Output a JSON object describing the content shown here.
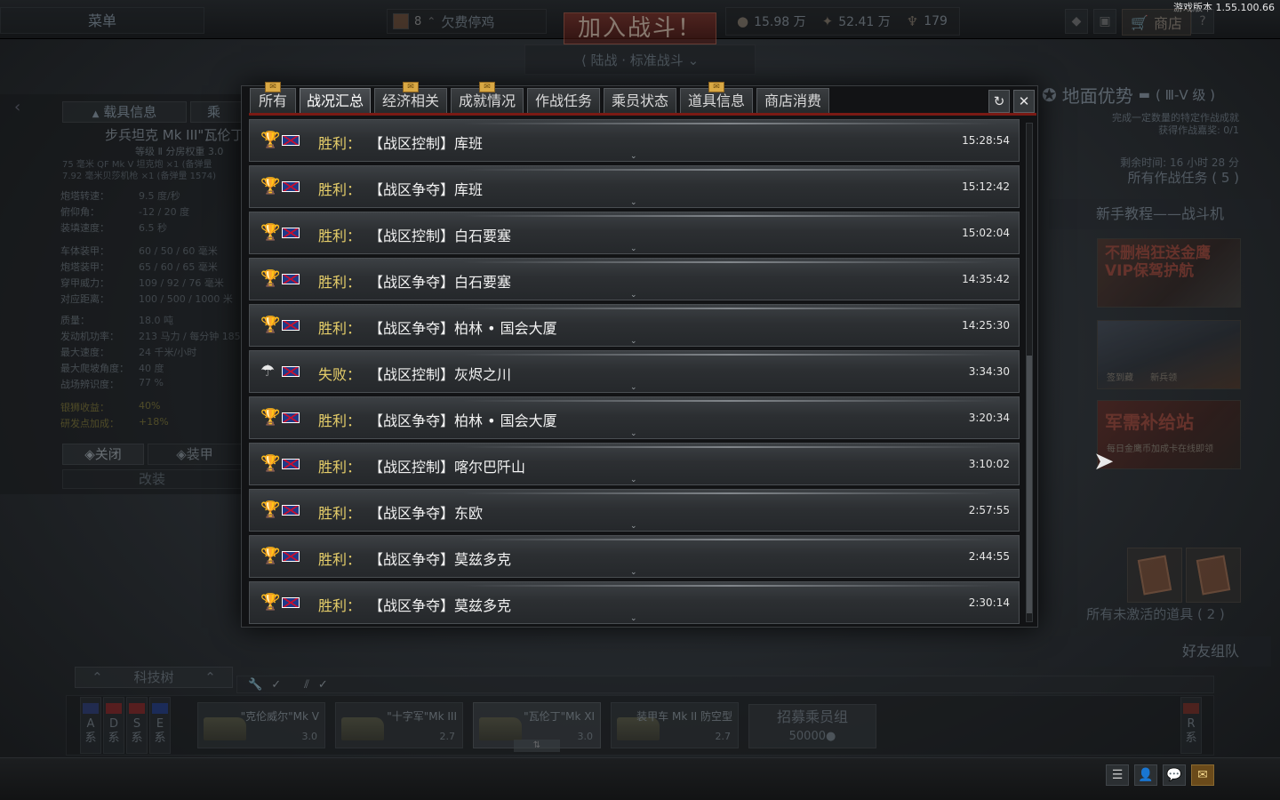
{
  "version": "游戏版本 1.55.100.66",
  "topbar": {
    "menu": "菜单",
    "player_level": "8",
    "player_name": "欠费停鸡",
    "join_battle": "加入战斗！",
    "battle_mode": "陆战 · 标准战斗",
    "silver_lions": "15.98 万",
    "research_points": "52.41 万",
    "golden_eagles": "179",
    "shop": "商店",
    "help": "?"
  },
  "left_panel": {
    "tab_vehicle": "载具信息",
    "tab_crew": "乘",
    "vehicle_name": "步兵坦克 Mk III\"瓦伦丁",
    "rank": "等级 Ⅱ  分房权重 3.0",
    "armament": [
      "75 毫米 QF Mk V 坦克炮 ×1 (备弹量",
      "7.92 毫米贝莎机枪 ×1 (备弹量 1574)"
    ],
    "stats": [
      {
        "label": "炮塔转速：",
        "value": "9.5 度/秒"
      },
      {
        "label": "俯仰角：",
        "value": "-12 / 20 度"
      },
      {
        "label": "装填速度：",
        "value": "6.5 秒"
      },
      {
        "label": "车体装甲：",
        "value": "60 / 50 / 60 毫米"
      },
      {
        "label": "炮塔装甲：",
        "value": "65 / 60 / 65 毫米"
      },
      {
        "label": "穿甲威力：",
        "value": "109 / 92 / 76 毫米"
      },
      {
        "label": "对应距离：",
        "value": "100 / 500 / 1000 米"
      },
      {
        "label": "质量：",
        "value": "18.0 吨"
      },
      {
        "label": "发动机功率：",
        "value": "213 马力 / 每分钟 185"
      },
      {
        "label": "最大速度：",
        "value": "24 千米/小时"
      },
      {
        "label": "最大爬坡角度：",
        "value": "40 度"
      },
      {
        "label": "战场辨识度：",
        "value": "77 %"
      },
      {
        "label": "银狮收益：",
        "value": "40%"
      },
      {
        "label": "研发点加成：",
        "value": "+18%"
      }
    ],
    "btn_close": "关闭",
    "btn_armor": "装甲",
    "btn_mod": "改装"
  },
  "right_panel": {
    "title": "地面优势",
    "tier": "( Ⅲ-Ⅴ 级 )",
    "sub1": "完成一定数量的特定作战成就",
    "sub2": "获得作战嘉奖: 0/1",
    "time_left": "剩余时间: 16 小时 28 分",
    "all_tasks": "所有作战任务 ( 5 )",
    "tutorial": "新手教程——战斗机",
    "banner1": "不删档狂送金鹰",
    "banner1b": "VIP保驾护航",
    "banner2a": "签到藏",
    "banner2b": "新兵领",
    "banner3": "军需补给站",
    "banner3b": "每日金鹰币加成卡在线即领",
    "inactive_items": "所有未激活的道具 ( 2 )",
    "friends": "好友组队"
  },
  "bottom": {
    "techtree": "科技树",
    "nations": [
      {
        "code": "A",
        "label": "系"
      },
      {
        "code": "D",
        "label": "系"
      },
      {
        "code": "S",
        "label": "系"
      },
      {
        "code": "E",
        "label": "系"
      }
    ],
    "nation_r": {
      "code": "R",
      "label": "系"
    },
    "vehicles": [
      {
        "name": "\"克伦威尔\"Mk V",
        "br": "3.0"
      },
      {
        "name": "\"十字军\"Mk III",
        "br": "2.7"
      },
      {
        "name": "\"瓦伦丁\"Mk XI",
        "br": "3.0"
      },
      {
        "name": "装甲车 Mk II 防空型",
        "br": "2.7"
      }
    ],
    "recruit_title": "招募乘员组",
    "recruit_cost": "50000"
  },
  "modal": {
    "tabs": [
      {
        "label": "所有",
        "mail": true,
        "active": false
      },
      {
        "label": "战况汇总",
        "mail": false,
        "active": true
      },
      {
        "label": "经济相关",
        "mail": true,
        "active": false
      },
      {
        "label": "成就情况",
        "mail": true,
        "active": false
      },
      {
        "label": "作战任务",
        "mail": false,
        "active": false
      },
      {
        "label": "乘员状态",
        "mail": false,
        "active": false
      },
      {
        "label": "道具信息",
        "mail": true,
        "active": false
      },
      {
        "label": "商店消费",
        "mail": false,
        "active": false
      }
    ],
    "refresh_icon": "↻",
    "close_icon": "✕",
    "rows": [
      {
        "result": "胜利",
        "mission": "【战区控制】库班",
        "time": "15:28:54"
      },
      {
        "result": "胜利",
        "mission": "【战区争夺】库班",
        "time": "15:12:42"
      },
      {
        "result": "胜利",
        "mission": "【战区控制】白石要塞",
        "time": "15:02:04"
      },
      {
        "result": "胜利",
        "mission": "【战区争夺】白石要塞",
        "time": "14:35:42"
      },
      {
        "result": "胜利",
        "mission": "【战区争夺】柏林 • 国会大厦",
        "time": "14:25:30"
      },
      {
        "result": "失败",
        "mission": "【战区控制】灰烬之川",
        "time": "3:34:30"
      },
      {
        "result": "胜利",
        "mission": "【战区争夺】柏林 • 国会大厦",
        "time": "3:20:34"
      },
      {
        "result": "胜利",
        "mission": "【战区控制】喀尔巴阡山",
        "time": "3:10:02"
      },
      {
        "result": "胜利",
        "mission": "【战区争夺】东欧",
        "time": "2:57:55"
      },
      {
        "result": "胜利",
        "mission": "【战区争夺】莫兹多克",
        "time": "2:44:55"
      },
      {
        "result": "胜利",
        "mission": "【战区争夺】莫兹多克",
        "time": "2:30:14"
      }
    ],
    "separator": "："
  },
  "colors": {
    "result_text": "#e7cf6a",
    "tab_underline": "#7a1a14",
    "join_button": "#7a2a20"
  }
}
